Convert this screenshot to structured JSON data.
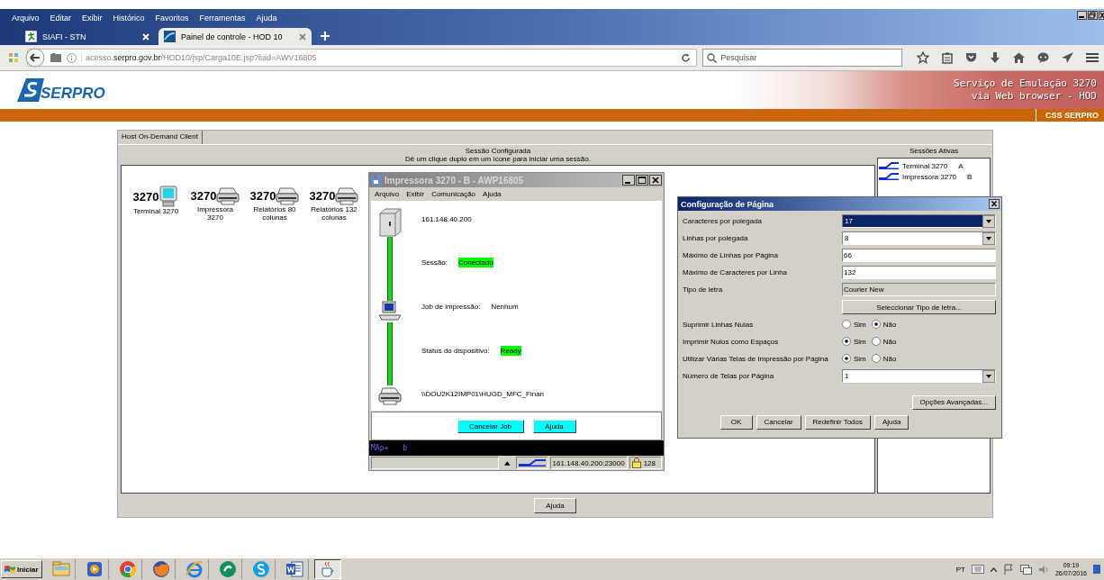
{
  "browser": {
    "menu": [
      "Arquivo",
      "Editar",
      "Exibir",
      "Histórico",
      "Favoritos",
      "Ferramentas",
      "Ajuda"
    ],
    "tabs": [
      {
        "title": "SIAFI - STN",
        "selected": false
      },
      {
        "title": "Painel de controle - HOD 10",
        "selected": true
      }
    ],
    "address": "acesso.**serpro.gov.br**/HOD10/jsp/Carga10E.jsp?luid=AWV16805",
    "search": {
      "placeholder": "Pesquisar"
    }
  },
  "header": {
    "logo": "SERPRO",
    "banner": [
      "Serviço de Emulação 3270",
      "via Web browser - HOD"
    ],
    "strip_label": "CSS SERPRO"
  },
  "applet": {
    "tab": "Host On-Demand Client",
    "title": "Sessão Configurada",
    "hint": "Dê um clique duplo em um ícone para iniciar uma sessão.",
    "sessions": [
      {
        "kind": "terminal",
        "number": "3270",
        "label": "Terminal 3270"
      },
      {
        "kind": "printer",
        "number": "3270",
        "label": "Impressora 3270"
      },
      {
        "kind": "printer",
        "number": "3270",
        "label": "Relatórios 80 colunas"
      },
      {
        "kind": "printer",
        "number": "3270",
        "label": "Relatórios 132 colunas"
      }
    ],
    "active_sessions": {
      "title": "Sessões Ativas",
      "items": [
        {
          "name": "Terminal 3270",
          "letter": "A"
        },
        {
          "name": "Impressora 3270",
          "letter": "B"
        }
      ]
    },
    "help_button": "Ajuda"
  },
  "printer_window": {
    "title": "Impressora 3270 - B - AWP16805",
    "active": false,
    "menu": [
      "Arquivo",
      "Exibir",
      "Comunicação",
      "Ajuda"
    ],
    "host": "161.148.40.200",
    "fields": [
      {
        "label": "Sessão:",
        "value": "Conectado",
        "highlight": true
      },
      {
        "label": "Job de impressão:",
        "value": "Nenhum",
        "highlight": false
      },
      {
        "label": "Status do dispositivo:",
        "value": "Ready",
        "highlight": true
      }
    ],
    "device": "\\\\DOU2K12IMP01\\HUGD_MFC_Finan",
    "buttons": [
      "Cancelar Job",
      "Ajuda"
    ],
    "oia": [
      "MAp+",
      "b"
    ],
    "status": {
      "address": "161.148.40.200:23000",
      "count": "128"
    }
  },
  "config_dialog": {
    "title": "Configuração de Página",
    "active": true,
    "rows": [
      {
        "kind": "select",
        "label": "Caracteres por polegada",
        "value": "17",
        "focused": true
      },
      {
        "kind": "select",
        "label": "Linhas por polegada",
        "value": "8",
        "focused": false
      },
      {
        "kind": "input",
        "label": "Máximo de Linhas por Página",
        "value": "66"
      },
      {
        "kind": "input",
        "label": "Máximo de Caracteres por Linha",
        "value": "132"
      },
      {
        "kind": "readonly",
        "label": "Tipo de letra",
        "value": "Courier New"
      },
      {
        "kind": "button",
        "label": "Seleccionar Tipo de letra..."
      },
      {
        "kind": "radio",
        "label": "Suprimir Linhas Nulas",
        "options": [
          {
            "label": "Sim",
            "selected": false
          },
          {
            "label": "Não",
            "selected": true
          }
        ]
      },
      {
        "kind": "radio",
        "label": "Imprimir Nulos como Espaços",
        "options": [
          {
            "label": "Sim",
            "selected": true
          },
          {
            "label": "Não",
            "selected": false
          }
        ]
      },
      {
        "kind": "radio",
        "label": "Utilizar Várias Telas de Impressão por Página",
        "options": [
          {
            "label": "Sim",
            "selected": true
          },
          {
            "label": "Não",
            "selected": false
          }
        ]
      },
      {
        "kind": "select",
        "label": "Número de Telas por Página",
        "value": "1",
        "focused": false
      }
    ],
    "advanced_button": "Opções Avançadas...",
    "buttons": [
      "OK",
      "Cancelar",
      "Redefinir Todos",
      "Ajuda"
    ]
  },
  "taskbar": {
    "start": "Iniciar",
    "apps": [
      {
        "kind": "folder",
        "selected": false
      },
      {
        "kind": "media",
        "selected": false
      },
      {
        "kind": "chrome",
        "selected": false
      },
      {
        "kind": "firefox",
        "selected": false
      },
      {
        "kind": "ie",
        "selected": false
      },
      {
        "kind": "green",
        "selected": false
      },
      {
        "kind": "skype",
        "selected": false
      },
      {
        "kind": "word",
        "selected": false
      },
      {
        "kind": "java",
        "selected": true
      }
    ],
    "language": "PT",
    "time": "09:19",
    "date": "26/07/2016"
  }
}
